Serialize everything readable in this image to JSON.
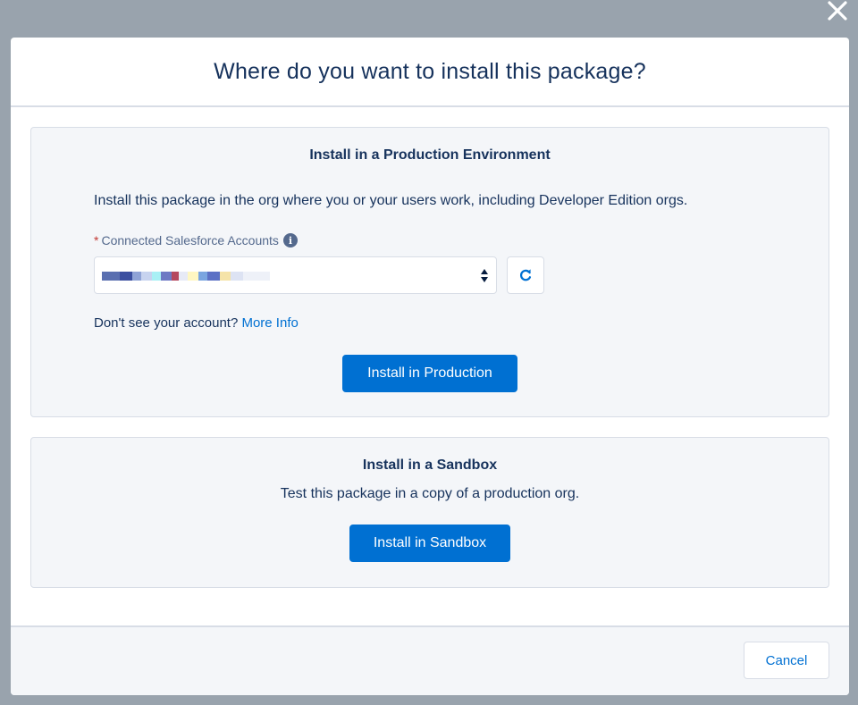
{
  "modal": {
    "title": "Where do you want to install this package?",
    "close_icon": "close-icon"
  },
  "production": {
    "title": "Install in a Production Environment",
    "description": "Install this package in the org where you or your users work, including Developer Edition orgs.",
    "field_required_mark": "*",
    "field_label": "Connected Salesforce Accounts",
    "info_icon": "i",
    "select_value": "",
    "refresh_icon": "refresh-icon",
    "help_prefix": "Don't see your account?",
    "help_link": "More Info",
    "button_label": "Install in Production"
  },
  "sandbox": {
    "title": "Install in a Sandbox",
    "description": "Test this package in a copy of a production org.",
    "button_label": "Install in Sandbox"
  },
  "footer": {
    "cancel_label": "Cancel"
  },
  "colors": {
    "brand": "#0070d2",
    "text": "#16325c",
    "overlay": "#99a3ad"
  }
}
